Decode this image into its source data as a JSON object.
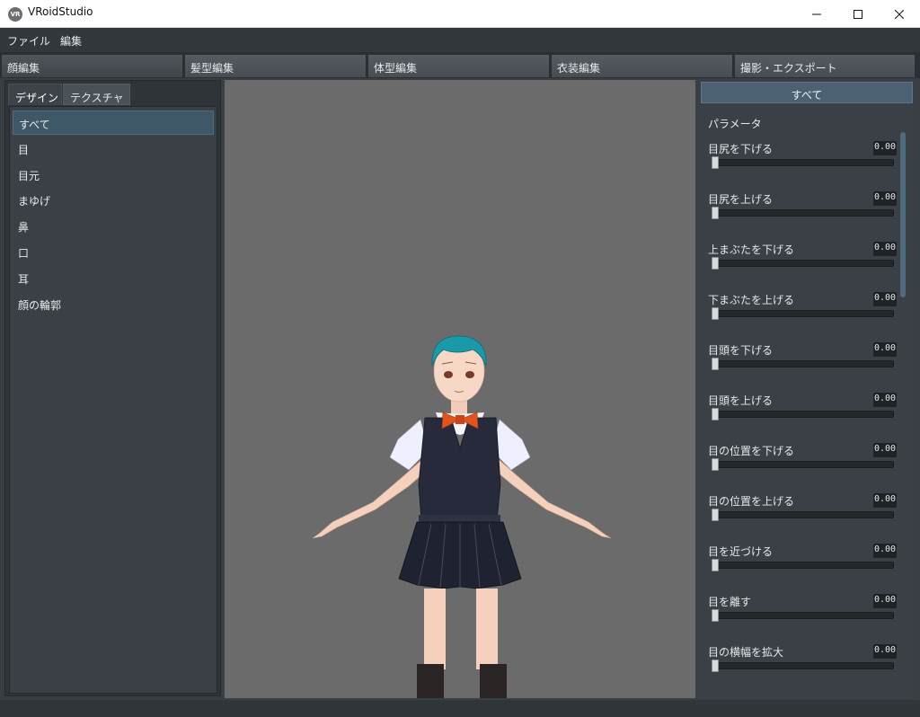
{
  "window": {
    "title": "VRoidStudio",
    "icon_text": "VR",
    "controls": [
      "minimize-icon",
      "maximize-icon",
      "close-icon"
    ]
  },
  "menu": [
    {
      "label": "ファイル"
    },
    {
      "label": "編集"
    }
  ],
  "top_tabs": [
    {
      "label": "顔編集",
      "active": true
    },
    {
      "label": "髪型編集",
      "active": false
    },
    {
      "label": "体型編集",
      "active": false
    },
    {
      "label": "衣装編集",
      "active": false
    },
    {
      "label": "撮影・エクスポート",
      "active": false
    }
  ],
  "left_panel": {
    "subtabs": [
      {
        "label": "デザイン",
        "active": true
      },
      {
        "label": "テクスチャ",
        "active": false
      }
    ],
    "categories": [
      {
        "label": "すべて",
        "selected": true
      },
      {
        "label": "目"
      },
      {
        "label": "目元"
      },
      {
        "label": "まゆげ"
      },
      {
        "label": "鼻"
      },
      {
        "label": "口"
      },
      {
        "label": "耳"
      },
      {
        "label": "顔の輪郭"
      }
    ]
  },
  "right_panel": {
    "header": "すべて",
    "section_title": "パラメータ",
    "params": [
      {
        "label": "目尻を下げる",
        "value": "0.00",
        "level": 0
      },
      {
        "label": "目尻を上げる",
        "value": "0.00",
        "level": 0
      },
      {
        "label": "上まぶたを下げる",
        "value": "0.00",
        "level": 0
      },
      {
        "label": "下まぶたを上げる",
        "value": "0.00",
        "level": 0
      },
      {
        "label": "目頭を下げる",
        "value": "0.00",
        "level": 0
      },
      {
        "label": "目頭を上げる",
        "value": "0.00",
        "level": 0
      },
      {
        "label": "目の位置を下げる",
        "value": "0.00",
        "level": 0
      },
      {
        "label": "目の位置を上げる",
        "value": "0.00",
        "level": 0
      },
      {
        "label": "目を近づける",
        "value": "0.00",
        "level": 0
      },
      {
        "label": "目を離す",
        "value": "0.00",
        "level": 0
      },
      {
        "label": "目の横幅を拡大",
        "value": "0.00",
        "level": 0
      }
    ]
  },
  "colors": {
    "accent": "#4c6272",
    "panel": "#3a4045",
    "viewport": "#6b6b6b",
    "hair": "#1a9aa8",
    "vest": "#262a3a",
    "bow": "#e0541e"
  }
}
